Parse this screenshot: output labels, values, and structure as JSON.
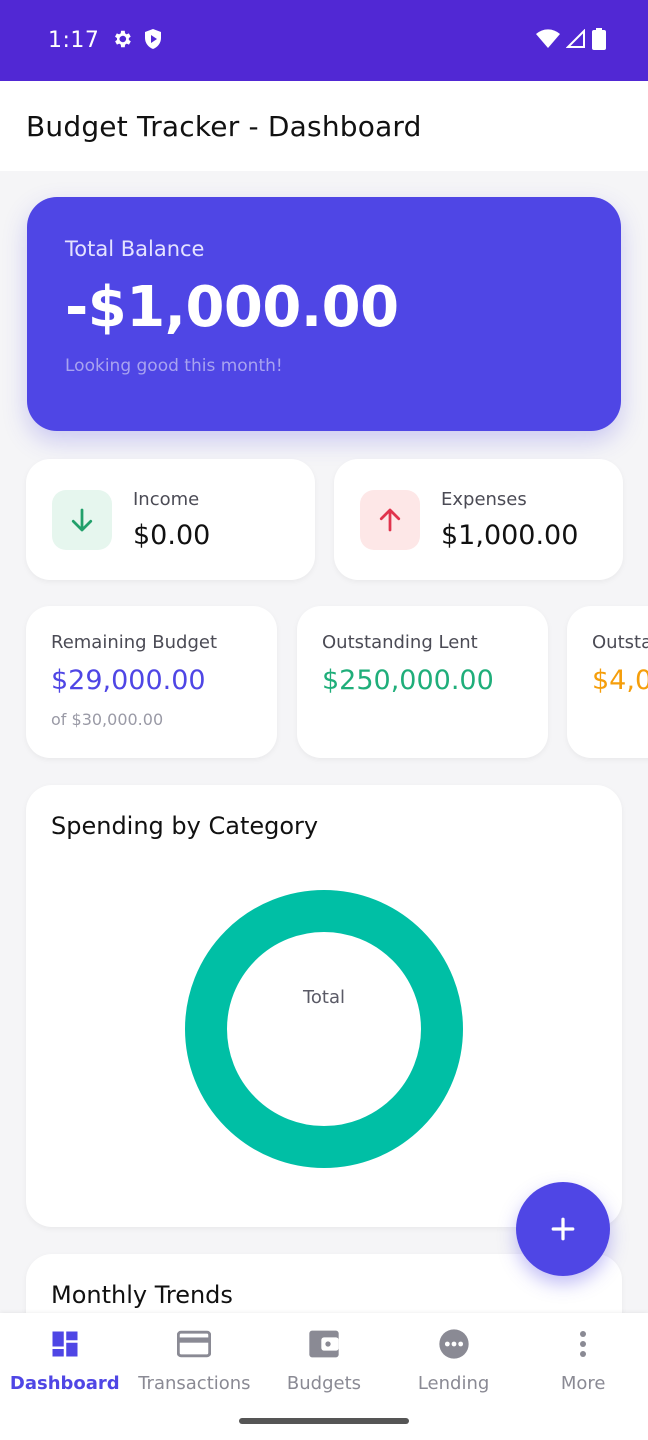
{
  "status_bar": {
    "time": "1:17"
  },
  "app_bar": {
    "title": "Budget Tracker - Dashboard"
  },
  "balance": {
    "label": "Total Balance",
    "amount": "-$1,000.00",
    "subtitle": "Looking good this month!"
  },
  "income": {
    "label": "Income",
    "value": "$0.00",
    "color": "#22a06b"
  },
  "expenses": {
    "label": "Expenses",
    "value": "$1,000.00",
    "color": "#e0344d"
  },
  "summary": [
    {
      "label": "Remaining Budget",
      "value": "$29,000.00",
      "sub": "of $30,000.00",
      "color": "#4f46e5"
    },
    {
      "label": "Outstanding Lent",
      "value": "$250,000.00",
      "color": "#1fae7a"
    },
    {
      "label": "Outsta",
      "value": "$4,0",
      "color": "#f59e0b"
    }
  ],
  "spending_chart": {
    "title": "Spending by Category",
    "center_label": "Total",
    "ring_color": "#00bfa5"
  },
  "trends": {
    "title": "Monthly Trends"
  },
  "bottom_nav": [
    {
      "label": "Dashboard",
      "icon": "dashboard-icon",
      "active": true
    },
    {
      "label": "Transactions",
      "icon": "credit-card-icon",
      "active": false
    },
    {
      "label": "Budgets",
      "icon": "wallet-icon",
      "active": false
    },
    {
      "label": "Lending",
      "icon": "more-horiz-circle-icon",
      "active": false
    },
    {
      "label": "More",
      "icon": "more-vert-icon",
      "active": false
    }
  ]
}
